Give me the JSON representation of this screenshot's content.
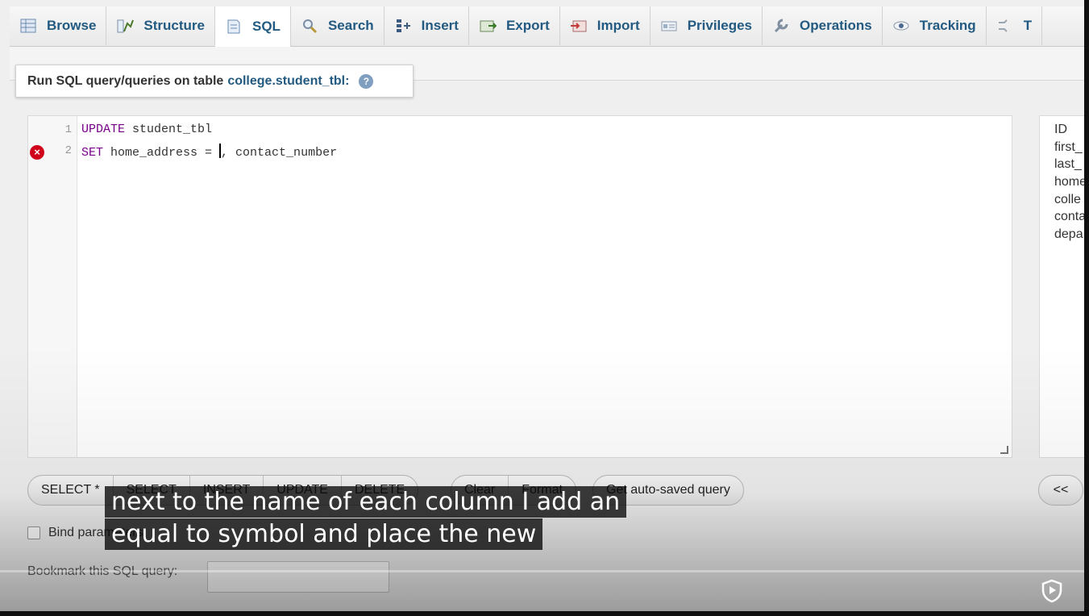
{
  "tabs": [
    {
      "label": "Browse",
      "icon": "browse-icon"
    },
    {
      "label": "Structure",
      "icon": "structure-icon"
    },
    {
      "label": "SQL",
      "icon": "sql-icon",
      "active": true
    },
    {
      "label": "Search",
      "icon": "search-icon"
    },
    {
      "label": "Insert",
      "icon": "insert-icon"
    },
    {
      "label": "Export",
      "icon": "export-icon"
    },
    {
      "label": "Import",
      "icon": "import-icon"
    },
    {
      "label": "Privileges",
      "icon": "privileges-icon"
    },
    {
      "label": "Operations",
      "icon": "wrench-icon"
    },
    {
      "label": "Tracking",
      "icon": "eye-icon"
    },
    {
      "label": "T",
      "icon": "triggers-icon"
    }
  ],
  "query_title": {
    "prefix": "Run SQL query/queries on table",
    "table": "college.student_tbl:",
    "help": "?"
  },
  "editor": {
    "lines": [
      {
        "number": "1",
        "keyword": "UPDATE",
        "rest": " student_tbl"
      },
      {
        "number": "2",
        "keyword": "SET",
        "rest_before_cursor": " home_address = ",
        "rest_after_cursor": ", contact_number"
      }
    ],
    "error_marker": "×"
  },
  "columns": [
    "ID",
    "first_",
    "last_",
    "home",
    "colle",
    "conta",
    "depa"
  ],
  "buttons": {
    "group1": [
      "SELECT *",
      "SELECT",
      "INSERT",
      "UPDATE",
      "DELETE"
    ],
    "group2": [
      "Clear",
      "Format"
    ],
    "auto_saved": "Get auto-saved query",
    "back": "<<"
  },
  "bind_params_label": "Bind parameters",
  "bookmark_label": "Bookmark this SQL query:",
  "subtitles": [
    "next to the name of each column I add an",
    "equal to symbol and place the new"
  ],
  "colors": {
    "tab_text": "#235a81",
    "keyword": "#770088",
    "error": "#d0021b"
  }
}
